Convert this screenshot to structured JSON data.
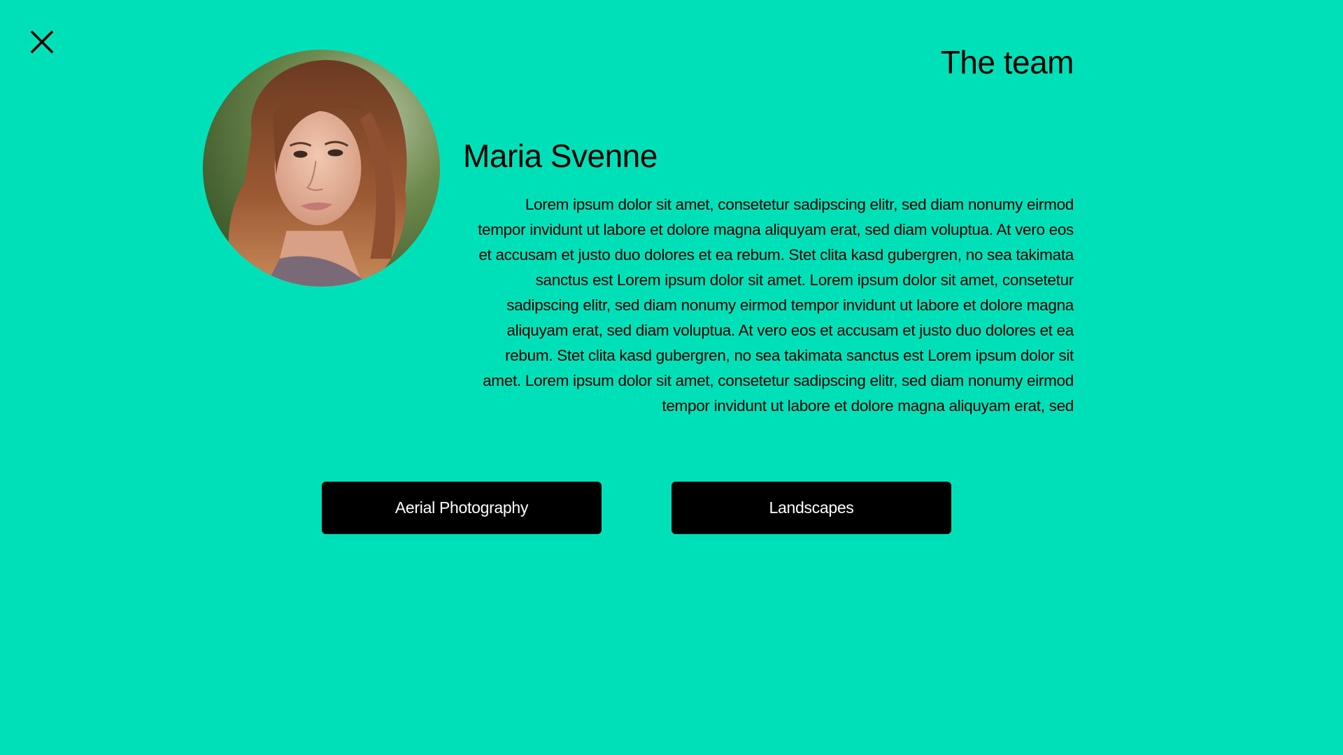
{
  "close": {
    "icon": "close-icon"
  },
  "header": {
    "title": "The team"
  },
  "member": {
    "photo_icon": "portrait-photo",
    "name": "Maria Svenne",
    "bio": "Lorem ipsum dolor sit amet, consetetur sadipscing elitr, sed diam nonumy eirmod tempor invidunt ut labore et dolore magna aliquyam erat, sed diam voluptua. At vero eos et accusam et justo duo dolores et ea rebum. Stet clita kasd gubergren, no sea takimata sanctus est Lorem ipsum dolor sit amet. Lorem ipsum dolor sit amet, consetetur sadipscing elitr, sed diam nonumy eirmod tempor invidunt ut labore et dolore magna aliquyam erat, sed diam voluptua. At vero eos et accusam et justo duo dolores et ea rebum. Stet clita kasd gubergren, no sea takimata sanctus est Lorem ipsum dolor sit amet. Lorem ipsum dolor sit amet, consetetur sadipscing elitr, sed diam nonumy eirmod tempor invidunt ut labore et dolore magna aliquyam erat, sed"
  },
  "tags": [
    {
      "label": "Aerial Photography"
    },
    {
      "label": "Landscapes"
    }
  ],
  "colors": {
    "background": "#00e0b8",
    "button": "#000000",
    "button_text": "#ffffff"
  }
}
